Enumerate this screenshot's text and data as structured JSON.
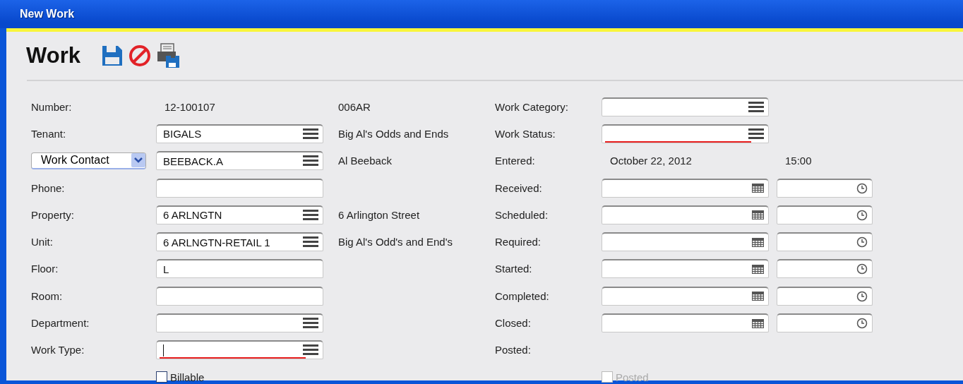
{
  "window": {
    "title": "New Work"
  },
  "header": {
    "title": "Work"
  },
  "left_rows": [
    {
      "kind": "text",
      "label": "Number:",
      "value": "12-100107",
      "description": "006AR"
    },
    {
      "kind": "lookup",
      "label": "Tenant:",
      "value": "BIGALS",
      "description": "Big Al's Odds and Ends",
      "required": false,
      "focused": false
    },
    {
      "kind": "select-lookup",
      "selector": "Work Contact",
      "value": "BEEBACK.A",
      "description": "Al Beeback",
      "required": false,
      "focused": false
    },
    {
      "kind": "input",
      "label": "Phone:",
      "required": false,
      "focused": false
    },
    {
      "kind": "lookup",
      "label": "Property:",
      "value": "6 ARLNGTN",
      "description": "6 Arlington Street",
      "required": false,
      "focused": false
    },
    {
      "kind": "lookup",
      "label": "Unit:",
      "value": "6 ARLNGTN-RETAIL 1",
      "description": "Big Al's Odd's and End's",
      "required": false,
      "focused": false
    },
    {
      "kind": "input",
      "label": "Floor:",
      "value": "L",
      "required": false,
      "focused": false
    },
    {
      "kind": "input",
      "label": "Room:",
      "required": false,
      "focused": false
    },
    {
      "kind": "lookup",
      "label": "Department:",
      "required": false,
      "focused": false
    },
    {
      "kind": "lookup",
      "label": "Work Type:",
      "required": true,
      "focused": true
    },
    {
      "kind": "checkbox",
      "label": "Billable",
      "checked": false,
      "disabled": false
    }
  ],
  "right_rows": [
    {
      "kind": "lookup",
      "label": "Work Category:",
      "required": false,
      "focused": false
    },
    {
      "kind": "lookup",
      "label": "Work Status:",
      "required": true,
      "focused": false
    },
    {
      "kind": "text",
      "label": "Entered:",
      "value": "October 22, 2012",
      "time": "15:00"
    },
    {
      "kind": "datetime",
      "label": "Received:"
    },
    {
      "kind": "datetime",
      "label": "Scheduled:"
    },
    {
      "kind": "datetime",
      "label": "Required:"
    },
    {
      "kind": "datetime",
      "label": "Started:"
    },
    {
      "kind": "datetime",
      "label": "Completed:"
    },
    {
      "kind": "datetime",
      "label": "Closed:"
    },
    {
      "kind": "label",
      "label": "Posted:"
    },
    {
      "kind": "checkbox",
      "label": "Posted",
      "checked": false,
      "disabled": true
    }
  ]
}
